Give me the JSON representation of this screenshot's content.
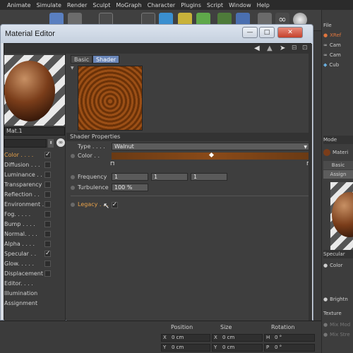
{
  "menubar": [
    "Animate",
    "Simulate",
    "Render",
    "Sculpt",
    "MoGraph",
    "Character",
    "Plugins",
    "Script",
    "Window",
    "Help"
  ],
  "window": {
    "title": "Material Editor",
    "min": "—",
    "max": "□",
    "close": "✕"
  },
  "left": {
    "material_name": "Mat.1",
    "channels": [
      {
        "label": "Color . . . .",
        "checked": true,
        "active": true
      },
      {
        "label": "Diffusion . . .",
        "checked": false
      },
      {
        "label": "Luminance . .",
        "checked": false
      },
      {
        "label": "Transparency",
        "checked": false
      },
      {
        "label": "Reflection . .",
        "checked": false
      },
      {
        "label": "Environment .",
        "checked": false
      },
      {
        "label": "Fog. . . . .",
        "checked": false
      },
      {
        "label": "Bump . . . .",
        "checked": false
      },
      {
        "label": "Normal. . . .",
        "checked": false
      },
      {
        "label": "Alpha . . . .",
        "checked": false
      },
      {
        "label": "Specular . .",
        "checked": true
      },
      {
        "label": "Glow. . . . .",
        "checked": false
      },
      {
        "label": "Displacement",
        "checked": false
      },
      {
        "label": "Editor. . . .",
        "checked": null
      },
      {
        "label": "Illumination",
        "checked": null
      },
      {
        "label": "Assignment",
        "checked": null
      }
    ]
  },
  "main": {
    "tabs": [
      "Basic",
      "Shader"
    ],
    "active_tab": "Shader",
    "section_title": "Shader Properties",
    "type_label": "Type . . . .",
    "type_value": "Walnut",
    "color_label": "Color . .",
    "frequency_label": "Frequency",
    "frequency_values": [
      "1",
      "1",
      "1"
    ],
    "turbulence_label": "Turbulence",
    "turbulence_value": "100 %",
    "legacy_label": "Legacy . . .",
    "legacy_checked": "✓"
  },
  "right": {
    "items": [
      "File",
      "XRef",
      "Cam",
      "Cam",
      "Cub"
    ],
    "mode": "Mode",
    "material": "Materi",
    "tabs": [
      "Basic",
      "Assign"
    ],
    "specular": "Specular",
    "color": "Color",
    "brightness": "Brightn",
    "texture": "Texture",
    "mix_mode": "Mix Mod",
    "mix_strength": "Mix Stre"
  },
  "bottom": {
    "headers": [
      "Position",
      "Size",
      "Rotation"
    ],
    "row1": [
      "X",
      "0 cm",
      "X",
      "0 cm",
      "H",
      "0 °"
    ],
    "row2": [
      "Y",
      "0 cm",
      "Y",
      "0 cm",
      "P",
      "0 °"
    ]
  },
  "colors": {
    "accent": "#e8a24a",
    "brand": "#4a6fb0",
    "highlight_tab": "#6a86b8"
  }
}
